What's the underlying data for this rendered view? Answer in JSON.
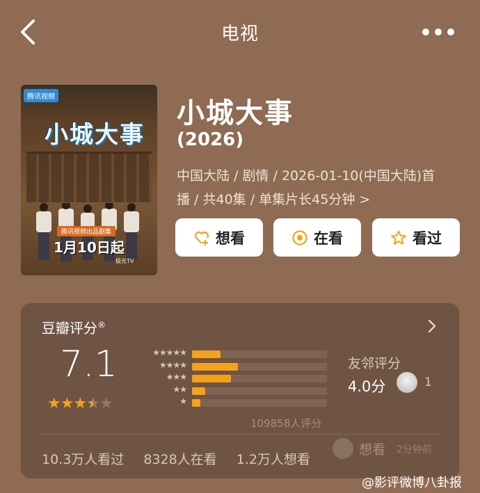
{
  "header": {
    "title": "电视",
    "back_icon": "back-arrow-icon",
    "more_icon": "more-dots-icon"
  },
  "poster": {
    "badge": "腾讯视频",
    "title": "小城大事",
    "tag": "腾讯视频出品剧集",
    "date": "1月10日起",
    "logo": "极光TV"
  },
  "show": {
    "name": "小城大事",
    "year": "(2026)",
    "meta_line1": "中国大陆 / 剧情 / 2026-01-10(中国大陆)首",
    "meta_line2": "播 / 共40集 / 单集片长45分钟",
    "meta_chevron": ">"
  },
  "actions": {
    "want": "想看",
    "watching": "在看",
    "watched": "看过"
  },
  "rating": {
    "header": "豆瓣评分",
    "header_mark": "®",
    "score": "7.1",
    "stars_value": 3.5,
    "stars_max": 5,
    "distribution": [
      {
        "label": "★★★★★",
        "fraction": 0.21
      },
      {
        "label": "★★★★",
        "fraction": 0.34
      },
      {
        "label": "★★★",
        "fraction": 0.29
      },
      {
        "label": "★★",
        "fraction": 0.1
      },
      {
        "label": "★",
        "fraction": 0.06
      }
    ],
    "votes": "109858人评分",
    "friend_label": "友邻评分",
    "friend_score": "4.0分",
    "friend_count": "1",
    "stats": [
      "10.3万人看过",
      "8328人在看",
      "1.2万人想看"
    ],
    "activity_text": "想看",
    "activity_time": "2分钟前"
  },
  "colors": {
    "accent": "#f4a21c",
    "background": "#8e6b52",
    "card": "#6f5443"
  },
  "watermark": "@影评微博八卦报"
}
